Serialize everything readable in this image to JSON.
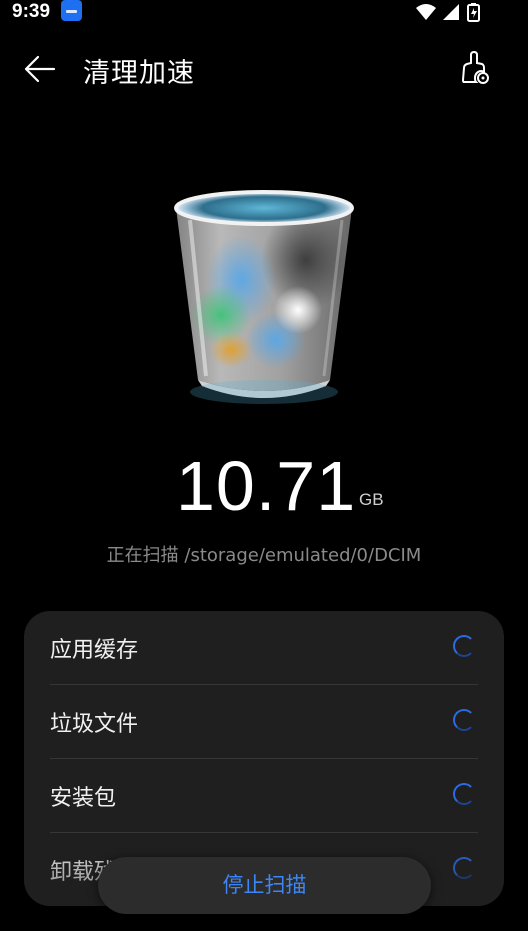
{
  "status_bar": {
    "time": "9:39",
    "app_icon": "app-notification-icon",
    "icons": [
      "wifi-icon",
      "signal-icon",
      "battery-charging-icon"
    ]
  },
  "app_bar": {
    "title": "清理加速",
    "back_icon": "arrow-left-icon",
    "settings_icon": "cleanup-settings-icon"
  },
  "illustration": {
    "icon": "trash-can-icon"
  },
  "scan": {
    "size_value": "10.71",
    "size_unit": "GB",
    "status_text": "正在扫描 /storage/emulated/0/DCIM"
  },
  "scan_items": [
    {
      "label": "应用缓存"
    },
    {
      "label": "垃圾文件"
    },
    {
      "label": "安装包"
    },
    {
      "label": "卸载残留"
    }
  ],
  "stop_button": {
    "label": "停止扫描"
  },
  "colors": {
    "background": "#000000",
    "card": "#1f1f1f",
    "accent": "#3d86f5",
    "secondary_text": "#8a8a8a"
  }
}
